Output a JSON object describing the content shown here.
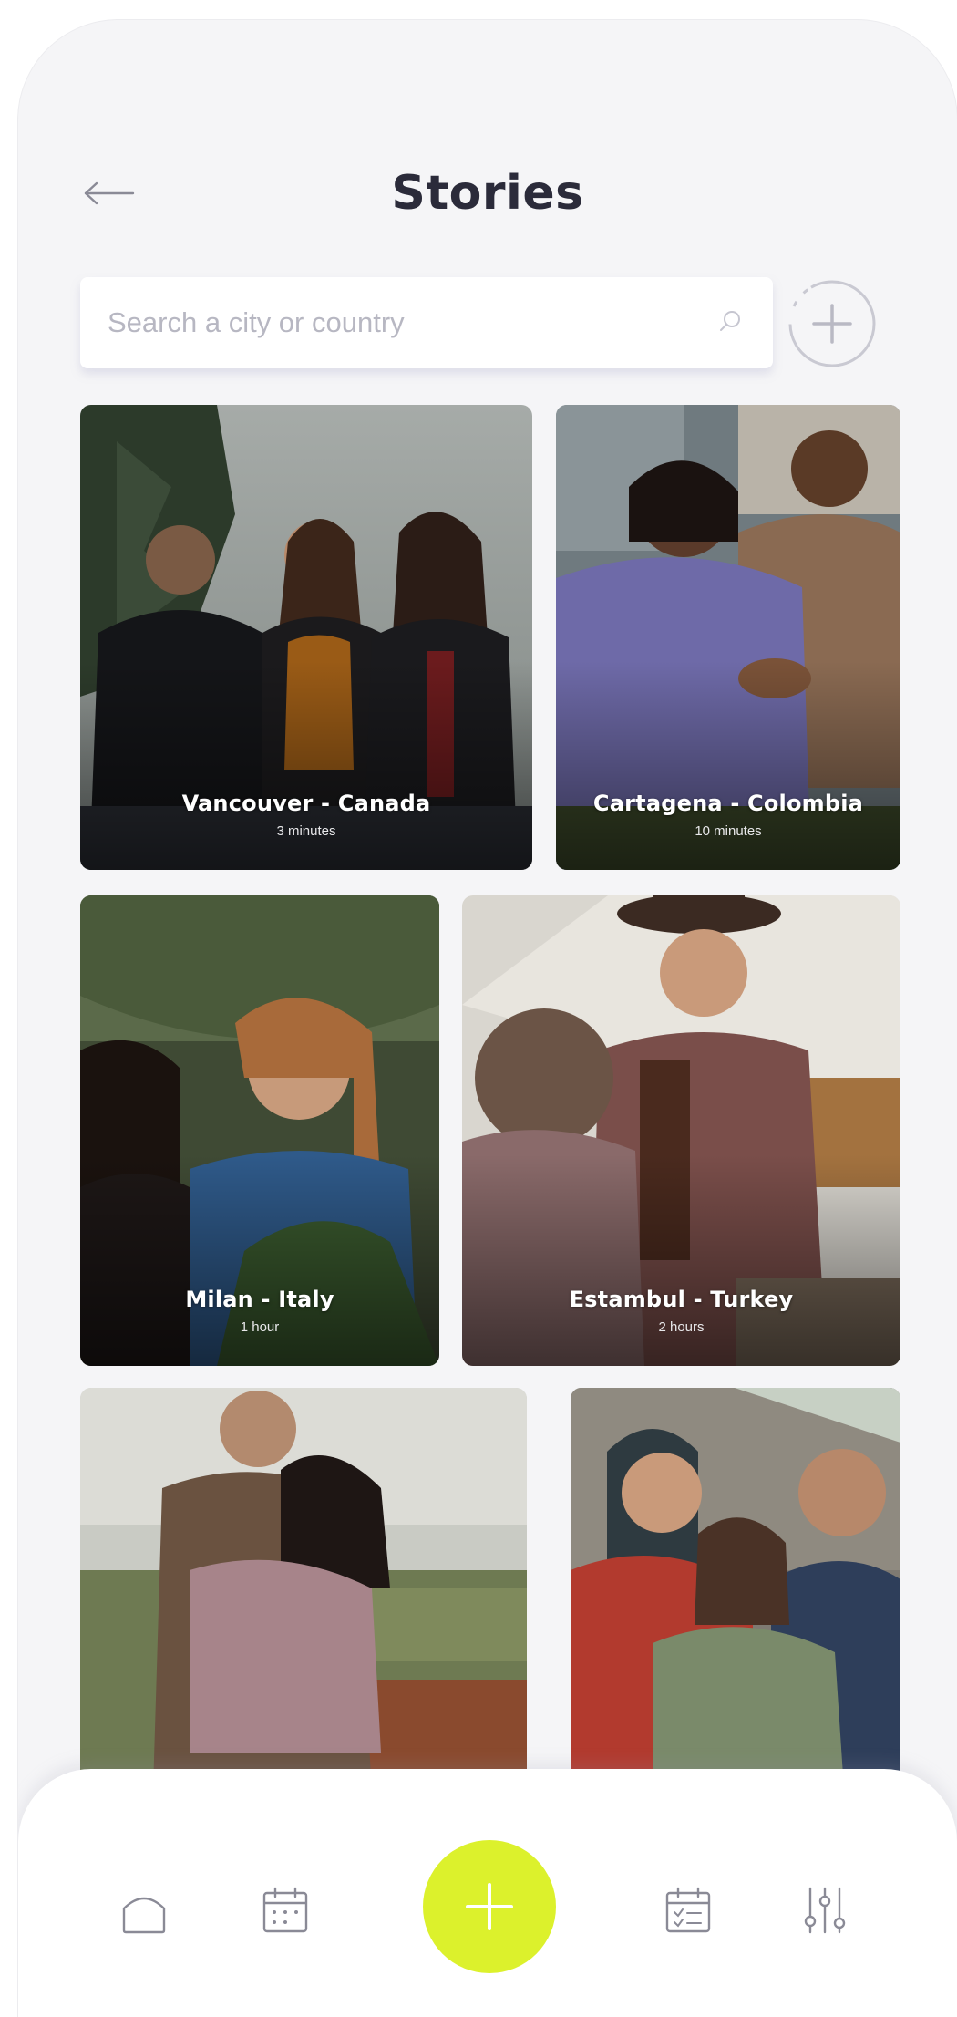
{
  "header": {
    "title": "Stories"
  },
  "search": {
    "placeholder": "Search a city or country"
  },
  "stories": [
    {
      "city": "Vancouver - Canada",
      "duration": "3 minutes"
    },
    {
      "city": "Cartagena - Colombia",
      "duration": "10 minutes"
    },
    {
      "city": "Milan - Italy",
      "duration": "1 hour"
    },
    {
      "city": "Estambul - Turkey",
      "duration": "2 hours"
    }
  ],
  "nav": {
    "icons": [
      "home-icon",
      "calendar-icon",
      "plus-icon",
      "checklist-icon",
      "sliders-icon"
    ]
  },
  "colors": {
    "accent": "#dcf12c",
    "title": "#2b2b3a",
    "background": "#f5f5f7",
    "icon": "#8a8a96"
  }
}
